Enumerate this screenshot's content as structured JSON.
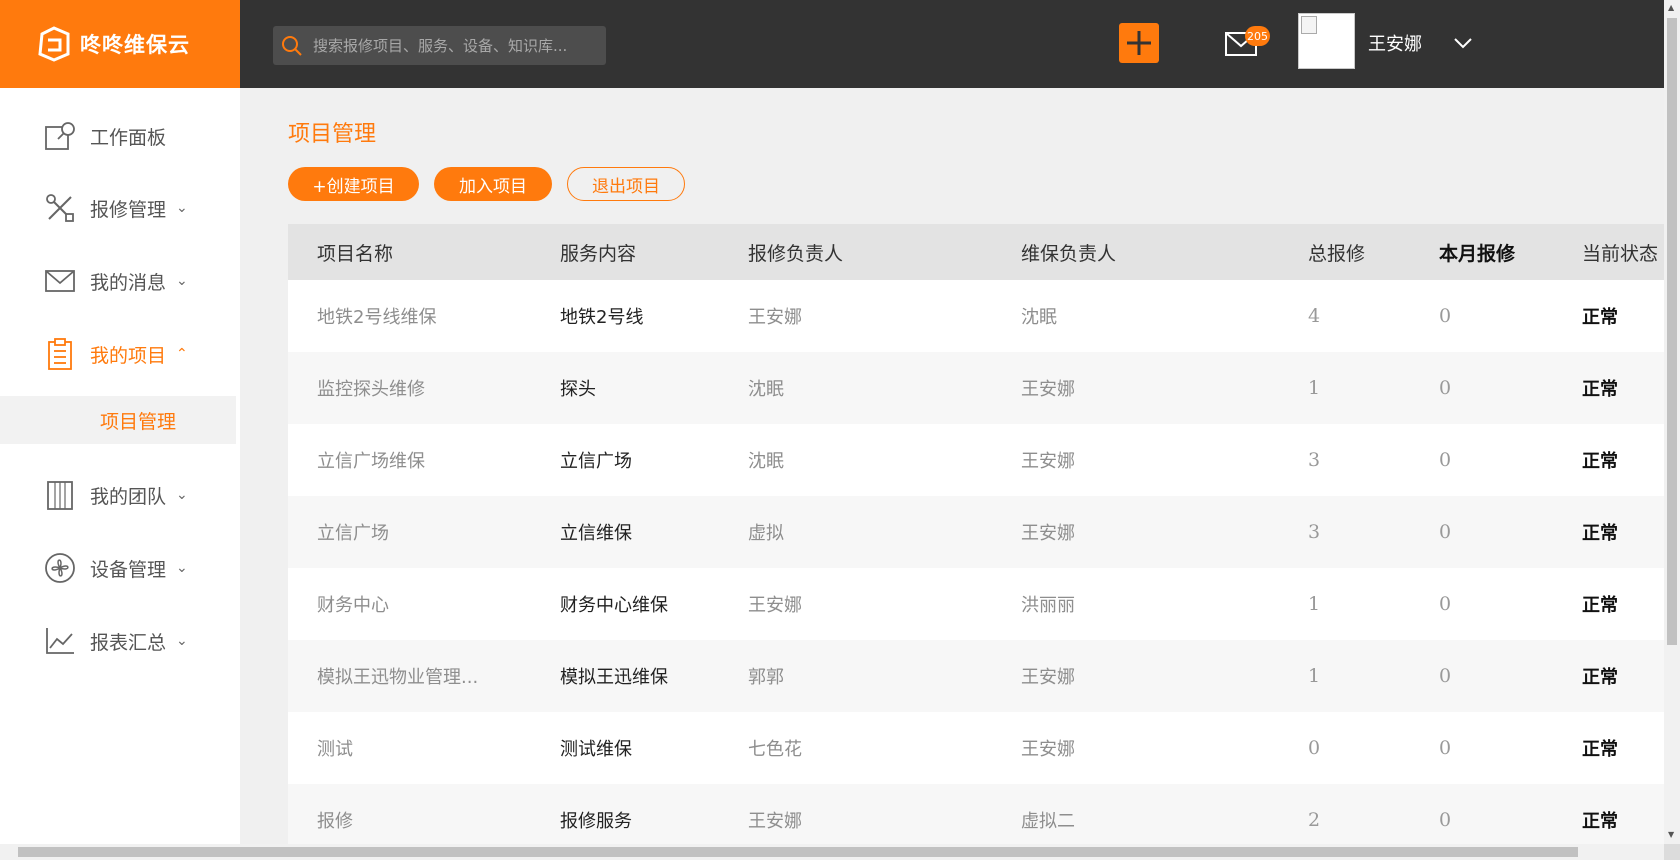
{
  "brand": {
    "name": "咚咚维保云",
    "color": "#ff7a0d"
  },
  "header": {
    "search_placeholder": "搜索报修项目、服务、设备、知识库...",
    "add_icon": "plus-icon",
    "mail_icon": "mail-icon",
    "mail_badge": "205",
    "user_name": "王安娜",
    "user_caret_icon": "chevron-down-icon"
  },
  "sidebar": {
    "items": [
      {
        "label": "工作面板",
        "icon": "edit-panel-icon",
        "caret": ""
      },
      {
        "label": "报修管理",
        "icon": "tools-icon",
        "caret": "⌄"
      },
      {
        "label": "我的消息",
        "icon": "mail-icon",
        "caret": "⌄"
      },
      {
        "label": "我的项目",
        "icon": "clipboard-icon",
        "caret": "⌃"
      },
      {
        "label": "我的团队",
        "icon": "building-icon",
        "caret": "⌄"
      },
      {
        "label": "设备管理",
        "icon": "fan-icon",
        "caret": "⌄"
      },
      {
        "label": "报表汇总",
        "icon": "chart-icon",
        "caret": "⌄"
      }
    ],
    "sub_item": "项目管理"
  },
  "main": {
    "title": "项目管理",
    "buttons": {
      "create": "+创建项目",
      "join": "加入项目",
      "exit": "退出项目"
    },
    "table": {
      "headers": [
        "项目名称",
        "服务内容",
        "报修负责人",
        "维保负责人",
        "总报修",
        "本月报修",
        "当前状态"
      ],
      "rows": [
        [
          "地铁2号线维保",
          "地铁2号线",
          "王安娜",
          "沈眠",
          "4",
          "0",
          "正常"
        ],
        [
          "监控探头维修",
          "探头",
          "沈眠",
          "王安娜",
          "1",
          "0",
          "正常"
        ],
        [
          "立信广场维保",
          "立信广场",
          "沈眠",
          "王安娜",
          "3",
          "0",
          "正常"
        ],
        [
          "立信广场",
          "立信维保",
          "虚拟",
          "王安娜",
          "3",
          "0",
          "正常"
        ],
        [
          "财务中心",
          "财务中心维保",
          "王安娜",
          "洪丽丽",
          "1",
          "0",
          "正常"
        ],
        [
          "模拟王迅物业管理...",
          "模拟王迅维保",
          "郭郭",
          "王安娜",
          "1",
          "0",
          "正常"
        ],
        [
          "测试",
          "测试维保",
          "七色花",
          "王安娜",
          "0",
          "0",
          "正常"
        ],
        [
          "报修",
          "报修服务",
          "王安娜",
          "虚拟二",
          "2",
          "0",
          "正常"
        ]
      ]
    }
  }
}
